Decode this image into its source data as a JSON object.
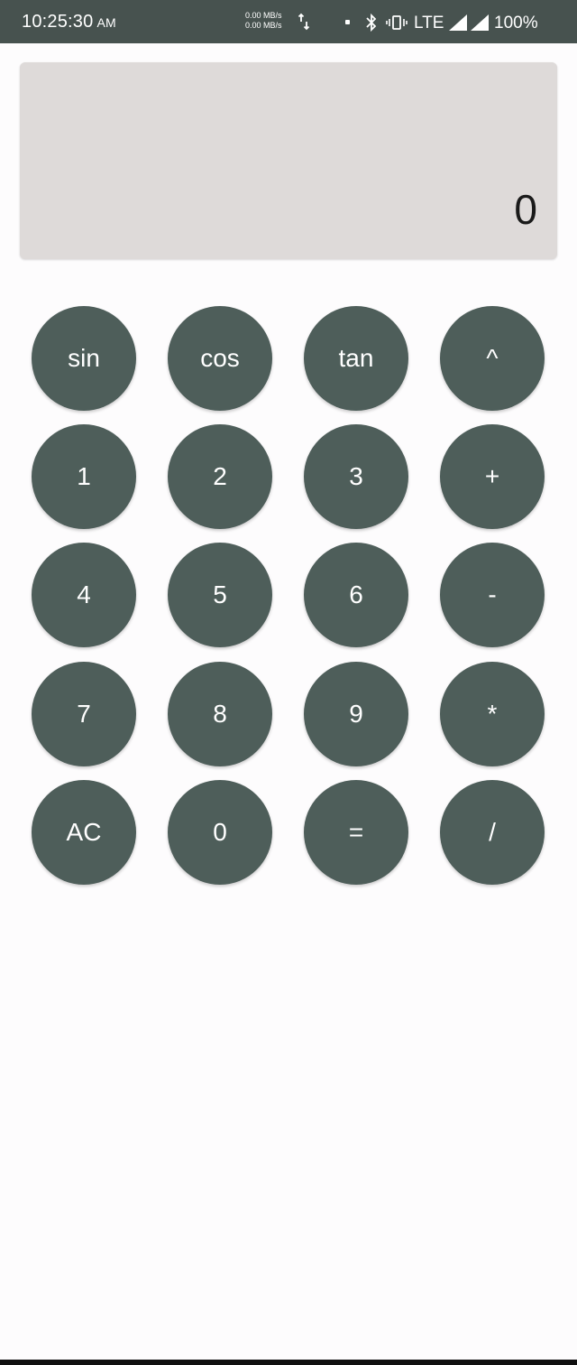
{
  "status_bar": {
    "time": "10:25:30",
    "ampm": "AM",
    "net_speed_up": "0.00 MB/s",
    "net_speed_down": "0.00 MB/s",
    "network": "LTE",
    "battery": "100%"
  },
  "display": {
    "value": "0"
  },
  "keys": {
    "sin": "sin",
    "cos": "cos",
    "tan": "tan",
    "power": "^",
    "one": "1",
    "two": "2",
    "three": "3",
    "plus": "+",
    "four": "4",
    "five": "5",
    "six": "6",
    "minus": "-",
    "seven": "7",
    "eight": "8",
    "nine": "9",
    "multiply": "*",
    "clear": "AC",
    "zero": "0",
    "equals": "=",
    "divide": "/"
  },
  "colors": {
    "status_bar": "#47524f",
    "display_bg": "#dedad9",
    "key_bg": "#4e5e5a",
    "key_text": "#ffffff",
    "page_bg": "#fdfcfd"
  }
}
